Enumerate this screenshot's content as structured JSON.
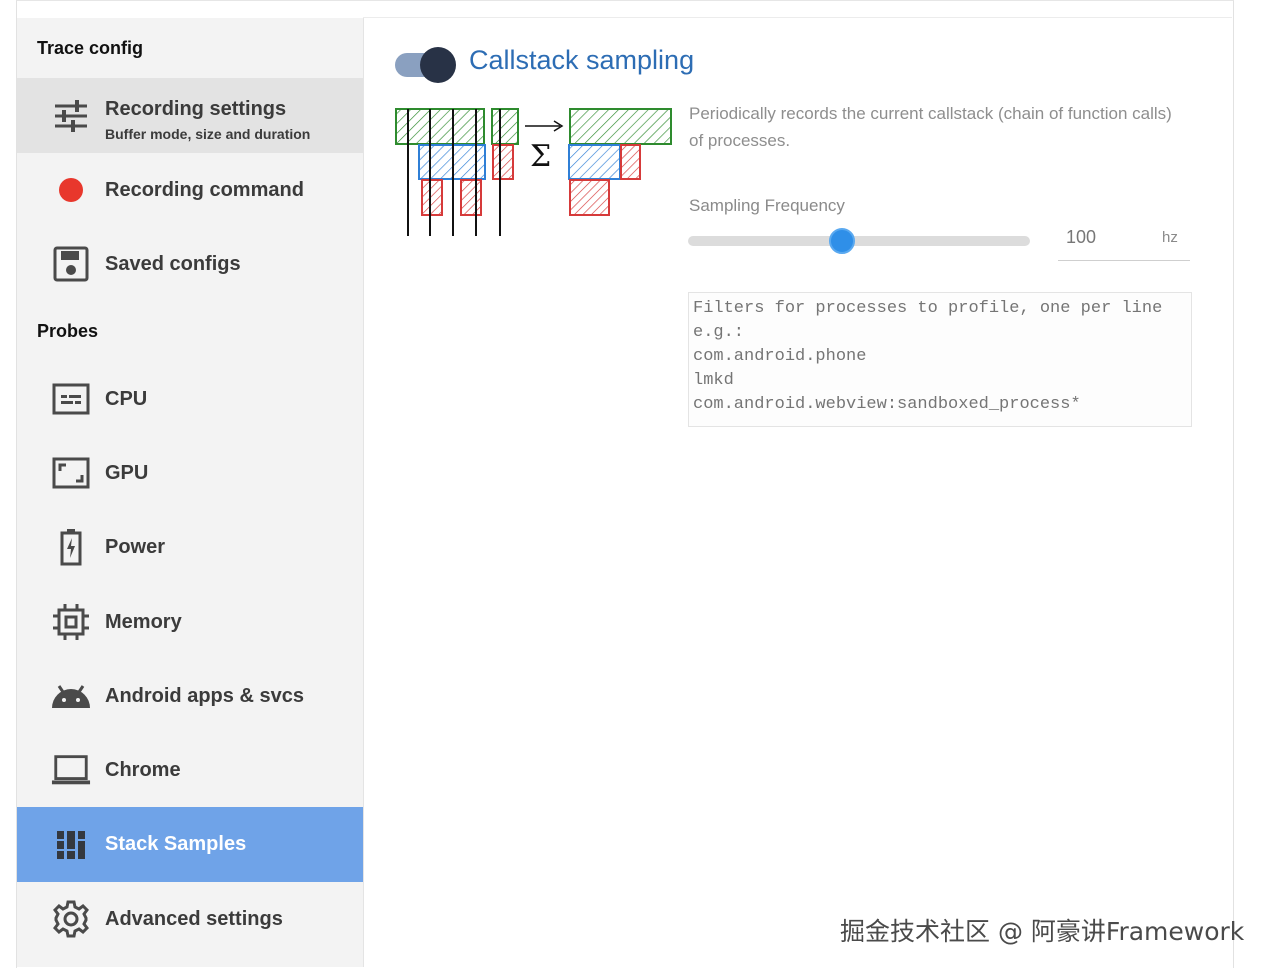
{
  "sidebar": {
    "trace_config_title": "Trace config",
    "probes_title": "Probes",
    "recording_settings": {
      "label": "Recording settings",
      "sublabel": "Buffer mode, size and duration"
    },
    "recording_command": {
      "label": "Recording command"
    },
    "saved_configs": {
      "label": "Saved configs"
    },
    "cpu": {
      "label": "CPU"
    },
    "gpu": {
      "label": "GPU"
    },
    "power": {
      "label": "Power"
    },
    "memory": {
      "label": "Memory"
    },
    "android": {
      "label": "Android apps & svcs"
    },
    "chrome": {
      "label": "Chrome"
    },
    "stack_samples": {
      "label": "Stack Samples"
    },
    "advanced": {
      "label": "Advanced settings"
    }
  },
  "main": {
    "title": "Callstack sampling",
    "enabled": true,
    "description": "Periodically records the current callstack (chain of function calls) of processes.",
    "frequency": {
      "label": "Sampling Frequency",
      "value": "100",
      "unit": "hz",
      "fraction": 0.45
    },
    "filters_placeholder": "Filters for processes to profile, one per line e.g.:\ncom.android.phone\nlmkd\ncom.android.webview:sandboxed_process*"
  },
  "watermark": "掘金技术社区 @ 阿豪讲Framework",
  "colors": {
    "accent_blue": "#2d6db4",
    "active_item": "#6fa3e8",
    "slider_thumb": "#2f8fe8",
    "record_dot": "#e8372c"
  }
}
